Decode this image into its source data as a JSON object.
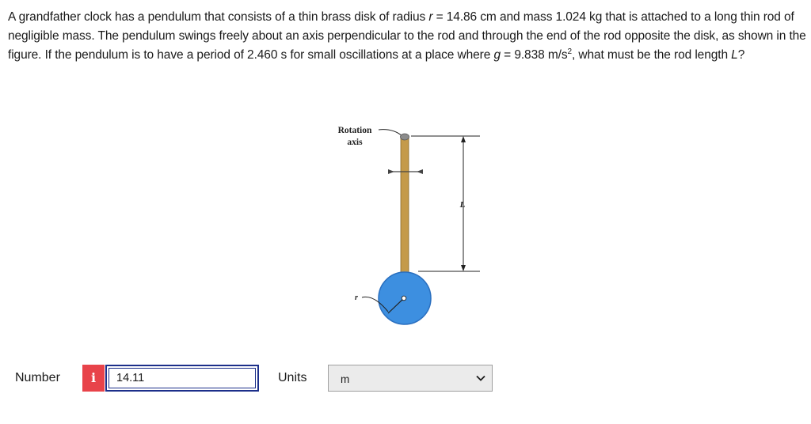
{
  "question": {
    "part1": "A grandfather clock has a pendulum that consists of a thin brass disk of radius ",
    "var_r": "r",
    "part2": " = 14.86 cm and mass 1.024 kg that is attached to a long thin rod of negligible mass. The pendulum swings freely about an axis perpendicular to the rod and through the end of the rod opposite the disk, as shown in the figure. If the pendulum is to have a period of 2.460 s for small oscillations at a place where ",
    "var_g": "g",
    "part3": " = 9.838 m/s",
    "exponent": "2",
    "part4": ", what must be the rod length ",
    "var_L": "L",
    "part5": "?"
  },
  "figure": {
    "rotation_label_line1": "Rotation",
    "rotation_label_line2": "axis",
    "length_label": "L",
    "radius_label": "r",
    "colors": {
      "rod": "#c49a4a",
      "disk": "#3d8fe0",
      "disk_edge": "#2a6fbf",
      "pivot": "#8c8c8c",
      "dimension_line": "#222222"
    }
  },
  "answer": {
    "number_label": "Number",
    "info_icon": "i",
    "number_value": "14.11",
    "units_label": "Units",
    "units_selected": "m",
    "units_dropdown_icon": "chevron-down-icon"
  }
}
